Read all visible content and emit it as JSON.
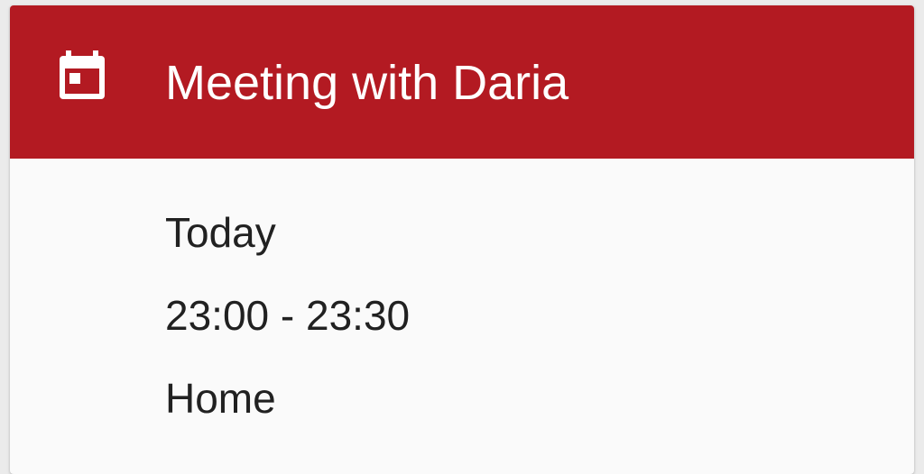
{
  "event": {
    "icon": "calendar-icon",
    "title": "Meeting with Daria",
    "date": "Today",
    "time": "23:00 - 23:30",
    "location": "Home"
  },
  "colors": {
    "header_background": "#b31a22",
    "header_text": "#ffffff",
    "body_background": "#fafafa",
    "body_text": "#212121"
  }
}
